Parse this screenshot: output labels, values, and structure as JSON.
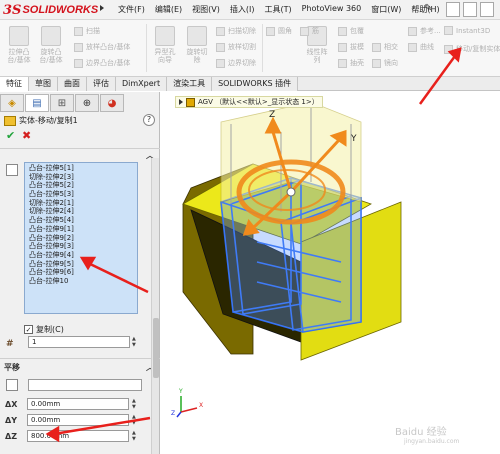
{
  "app": {
    "logo_prefix": "3S",
    "logo_text": "SOLIDWORKS",
    "menu": [
      "文件(F)",
      "编辑(E)",
      "视图(V)",
      "插入(I)",
      "工具(T)",
      "PhotoView 360",
      "窗口(W)",
      "帮助(H)"
    ],
    "pin_icon": "pin-icon"
  },
  "ribbon": {
    "big_buttons": [
      {
        "label": "拉伸凸\n台/基体"
      },
      {
        "label": "旋转凸\n台/基体"
      },
      {
        "label": "异型孔\n向导"
      },
      {
        "label": "旋转切\n除"
      },
      {
        "label": "线性阵\n列"
      }
    ],
    "small_buttons": [
      {
        "label": "扫描"
      },
      {
        "label": "放样凸台/基体"
      },
      {
        "label": "边界凸台/基体"
      },
      {
        "label": "扫描切除"
      },
      {
        "label": "放样切割"
      },
      {
        "label": "边界切除"
      },
      {
        "label": "圆角"
      },
      {
        "label": "包覆"
      },
      {
        "label": "拔模"
      },
      {
        "label": "相交"
      },
      {
        "label": "抽壳"
      },
      {
        "label": "镜向"
      },
      {
        "label": "筋"
      },
      {
        "label": "参考..."
      },
      {
        "label": "曲线"
      },
      {
        "label": "Instant3D"
      },
      {
        "label": "移动/复制实体"
      }
    ]
  },
  "tabs": [
    "特征",
    "草图",
    "曲面",
    "评估",
    "DimXpert",
    "渲染工具",
    "SOLIDWORKS 插件"
  ],
  "active_tab": 0,
  "panel": {
    "tab_icons": [
      "feature-manager-icon",
      "property-manager-icon",
      "configuration-manager-icon",
      "dimxpert-manager-icon",
      "display-manager-icon"
    ],
    "title": "实体-移动/复制1",
    "help": "?",
    "ok_symbol": "✔",
    "cancel_symbol": "✖",
    "bodies": [
      "凸台-拉伸5[1]",
      "切除-拉伸2[3]",
      "凸台-拉伸5[2]",
      "凸台-拉伸5[3]",
      "切除-拉伸2[1]",
      "切除-拉伸2[4]",
      "凸台-拉伸5[4]",
      "凸台-拉伸9[1]",
      "凸台-拉伸9[2]",
      "凸台-拉伸9[3]",
      "凸台-拉伸9[4]",
      "凸台-拉伸9[5]",
      "凸台-拉伸9[6]",
      "凸台-拉伸10"
    ],
    "copy_label": "复制(C)",
    "copy_checked": true,
    "copies_value": "1",
    "translate_header": "平移",
    "dx_label": "ΔX",
    "dy_label": "ΔY",
    "dz_label": "ΔZ",
    "dx_value": "0.00mm",
    "dy_value": "0.00mm",
    "dz_value": "800.00mm"
  },
  "viewport": {
    "tree_text": "AGV （默认<<默认>_显示状态 1>）",
    "axis_z": "Z",
    "axis_y": "Y",
    "triad_labels": [
      "Y",
      "X",
      "Z"
    ],
    "watermark": "Baidu 经验",
    "watermark_url": "jingyan.baidu.com",
    "colors": {
      "body": "#e7e400",
      "selected": "#2f6cf2",
      "handle": "#f08a1c",
      "annotation": "#e8201c"
    }
  }
}
